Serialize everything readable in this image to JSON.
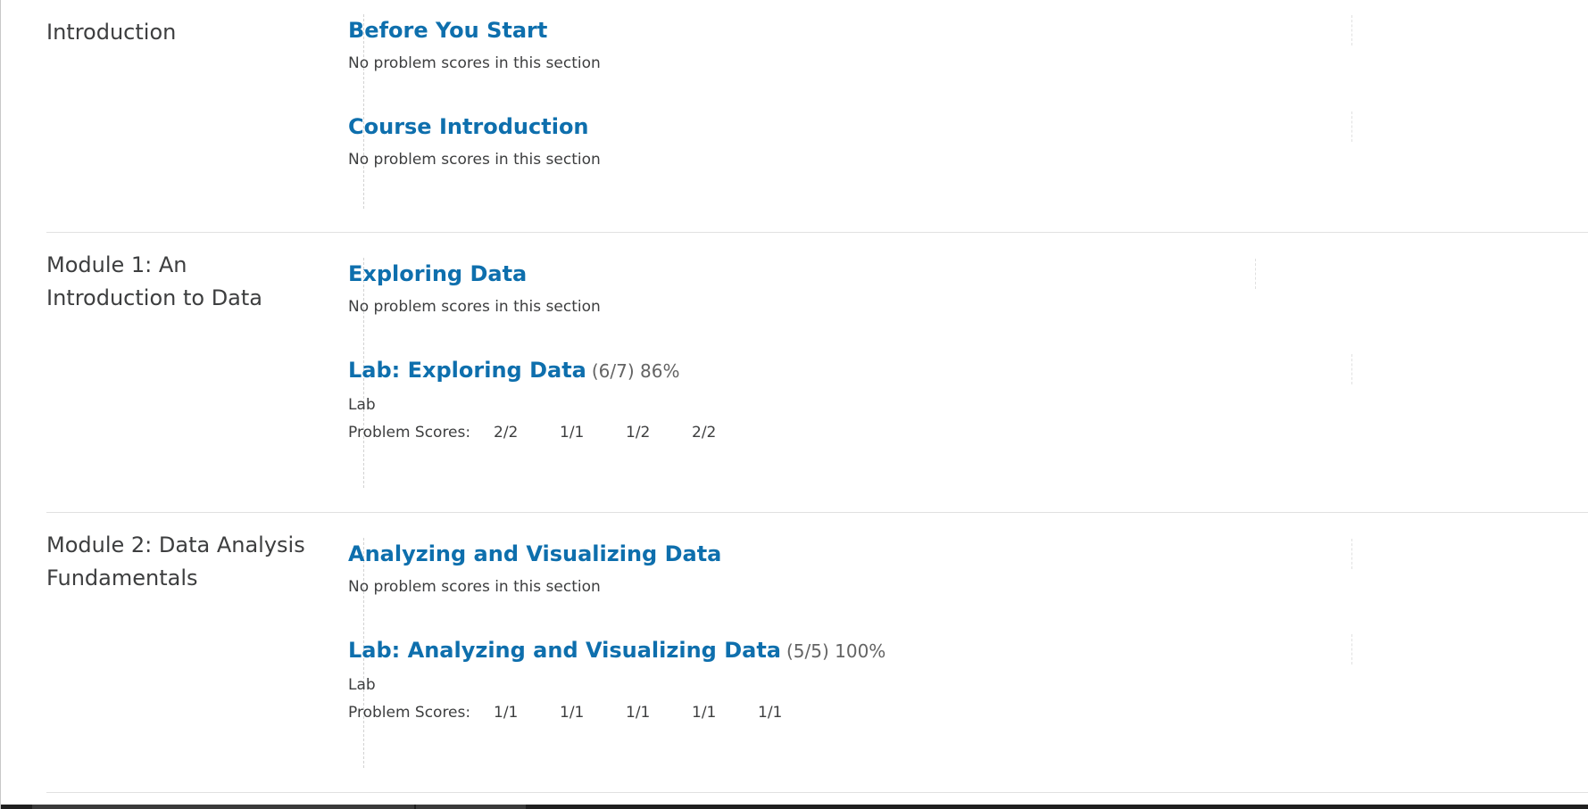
{
  "chapters": [
    {
      "title": "Introduction",
      "sections": [
        {
          "title": "Before You Start",
          "note": "No problem scores in this section"
        },
        {
          "title": "Course Introduction",
          "note": "No problem scores in this section"
        }
      ]
    },
    {
      "title": "Module 1: An Introduction to Data",
      "sections": [
        {
          "title": "Exploring Data",
          "note": "No problem scores in this section"
        },
        {
          "title": "Lab: Exploring Data",
          "score": "(6/7) 86%",
          "format": "Lab",
          "scores_label": "Problem Scores:",
          "scores": [
            "2/2",
            "1/1",
            "1/2",
            "2/2"
          ]
        }
      ]
    },
    {
      "title": "Module 2: Data Analysis Fundamentals",
      "sections": [
        {
          "title": "Analyzing and Visualizing Data",
          "note": "No problem scores in this section"
        },
        {
          "title": "Lab: Analyzing and Visualizing Data",
          "score": "(5/5) 100%",
          "format": "Lab",
          "scores_label": "Problem Scores:",
          "scores": [
            "1/1",
            "1/1",
            "1/1",
            "1/1",
            "1/1"
          ]
        }
      ]
    }
  ],
  "colors": {
    "link": "#0e6fad",
    "text": "#3d3e3f",
    "muted": "#646464",
    "divider": "#e1e1e1"
  }
}
